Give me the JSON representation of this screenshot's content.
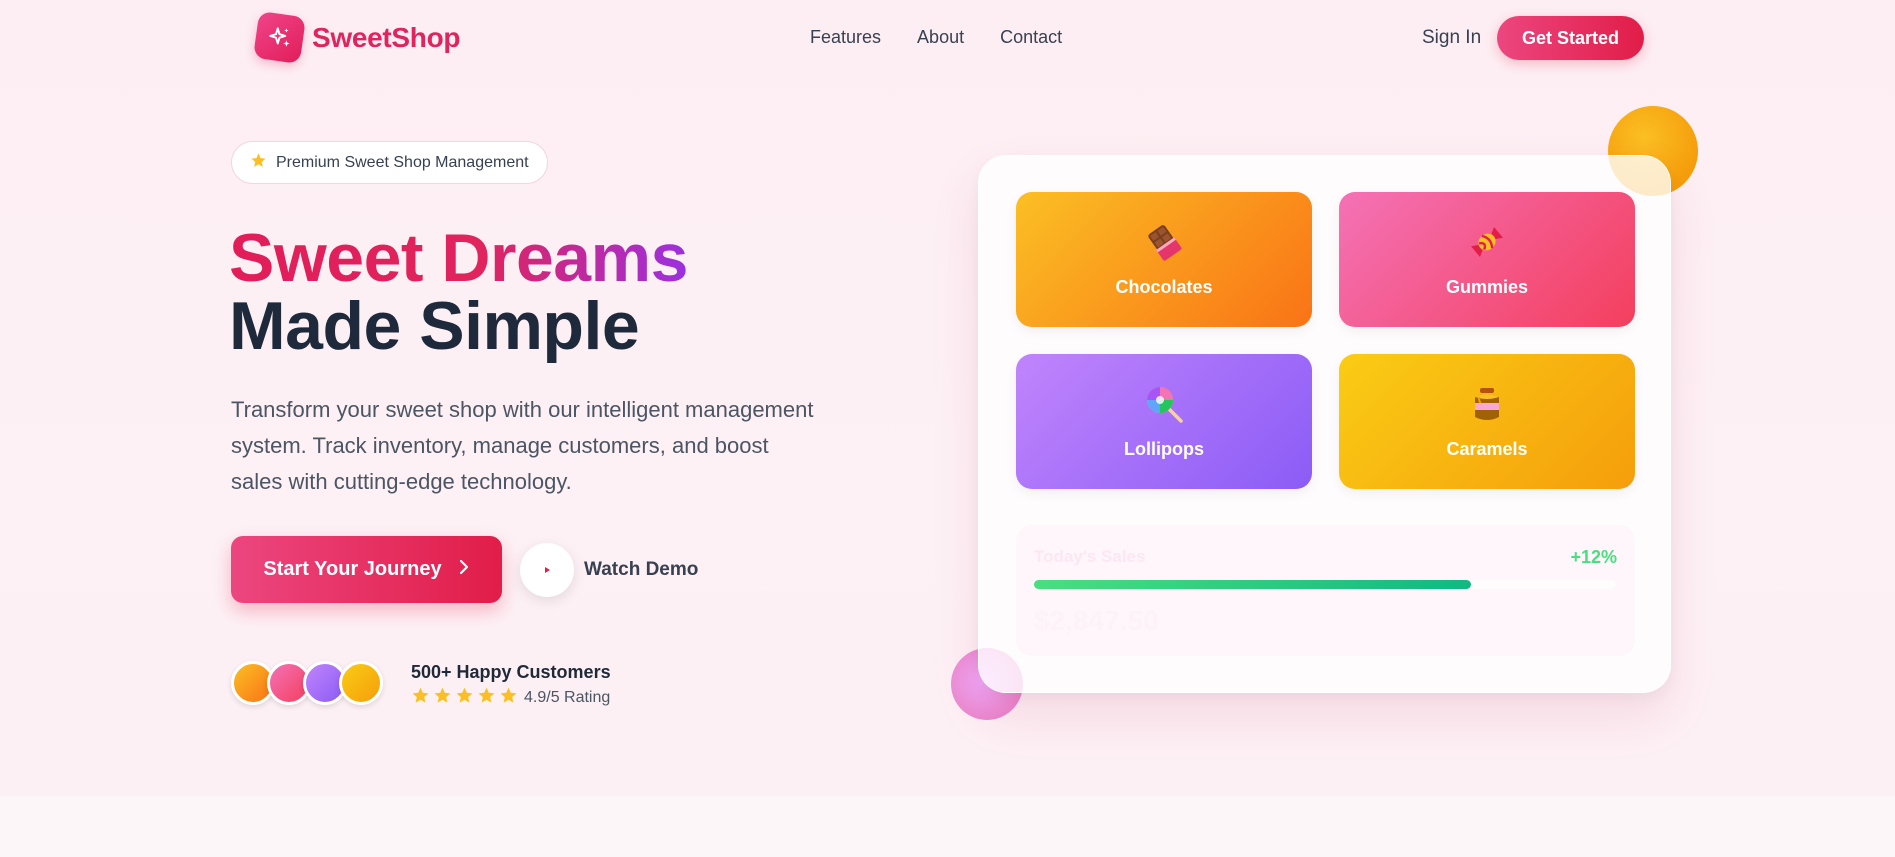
{
  "brand": {
    "name": "SweetShop"
  },
  "nav": {
    "links": [
      "Features",
      "About",
      "Contact"
    ],
    "signin_label": "Sign In",
    "cta_label": "Get Started"
  },
  "hero": {
    "badge": "Premium Sweet Shop Management",
    "headline_line1": "Sweet Dreams",
    "headline_line2": "Made Simple",
    "lead": "Transform your sweet shop with our intelligent management system. Track inventory, manage customers, and boost sales with cutting-edge technology.",
    "primary_cta": "Start Your Journey",
    "secondary_cta": "Watch Demo",
    "social_proof": {
      "title": "500+ Happy Customers",
      "rating_text": "4.9/5 Rating",
      "stars": 5
    }
  },
  "dashboard": {
    "categories": [
      {
        "label": "Chocolates",
        "icon": "chocolate-bar-icon"
      },
      {
        "label": "Gummies",
        "icon": "candy-icon"
      },
      {
        "label": "Lollipops",
        "icon": "lollipop-icon"
      },
      {
        "label": "Caramels",
        "icon": "honey-pot-icon"
      }
    ],
    "sales": {
      "label": "Today's Sales",
      "change": "+12%",
      "amount": "$2,847.50",
      "progress_percent": 75
    }
  },
  "colors": {
    "brand_pink": "#e0245e",
    "accent_purple": "#9b30e0",
    "success_green": "#4ade80",
    "star_gold": "#fbbf24"
  }
}
